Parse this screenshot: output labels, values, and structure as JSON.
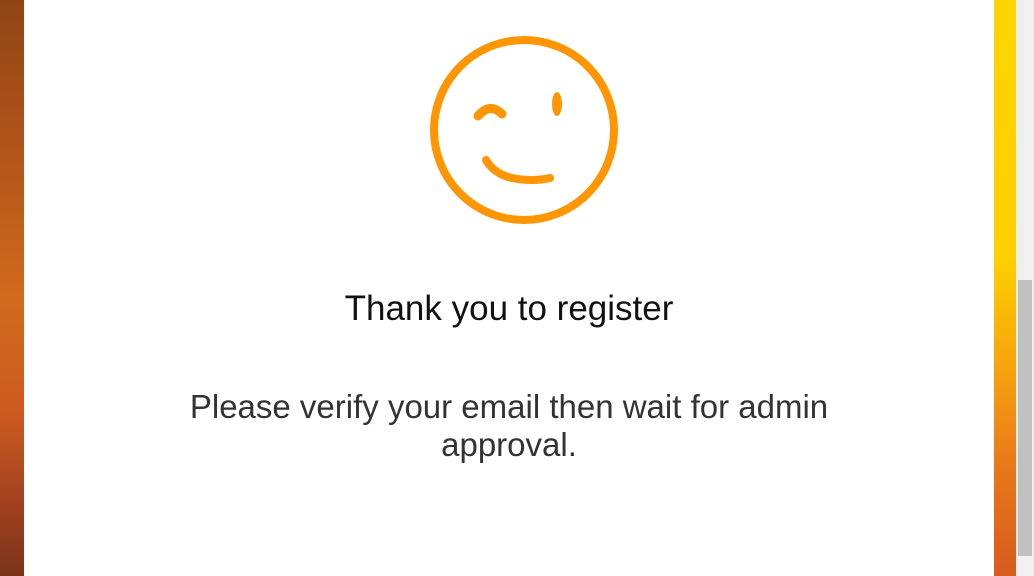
{
  "colors": {
    "accent": "#ff9500",
    "title_text": "#111111",
    "body_text": "#333333"
  },
  "icon": "wink-smiley-icon",
  "confirmation": {
    "title": "Thank you to register",
    "message": "Please verify your email then wait for admin approval."
  }
}
